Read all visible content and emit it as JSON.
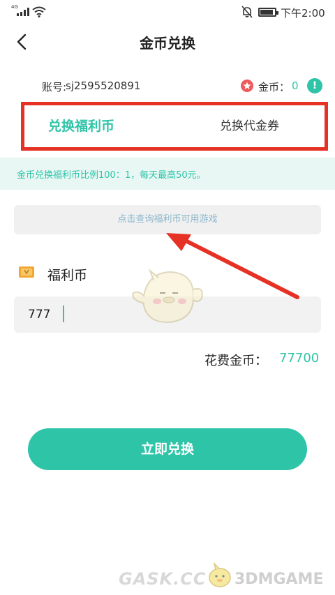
{
  "status_bar": {
    "signal_label": "4G",
    "time": "下午2:00"
  },
  "header": {
    "title": "金币兑换"
  },
  "account": {
    "label": "账号:",
    "value": "sj2595520891",
    "coin_label": "金币：",
    "coin_value": "0",
    "info_icon_text": "!"
  },
  "tabs": [
    {
      "label": "兑换福利币",
      "active": true
    },
    {
      "label": "兑换代金券",
      "active": false
    }
  ],
  "notice": {
    "text": "金币兑换福利币比例100：1，每天最高50元。"
  },
  "query_button": {
    "label": "点击查询福利币可用游戏"
  },
  "welfare": {
    "label": "福利币"
  },
  "amount_input": {
    "value": "777"
  },
  "cost": {
    "label": "花费金币：",
    "value": "77700"
  },
  "submit": {
    "label": "立即兑换"
  },
  "watermark": {
    "left": "GASK.CC",
    "right": "3DMGAME"
  },
  "colors": {
    "accent": "#2ec4a8",
    "highlight_border": "#e63125",
    "notice_bg": "#e8f7f4"
  },
  "icons": [
    "signal-icon",
    "wifi-icon",
    "bell-off-icon",
    "battery-icon",
    "back-arrow-icon",
    "coin-star-icon",
    "info-icon",
    "ticket-icon"
  ]
}
